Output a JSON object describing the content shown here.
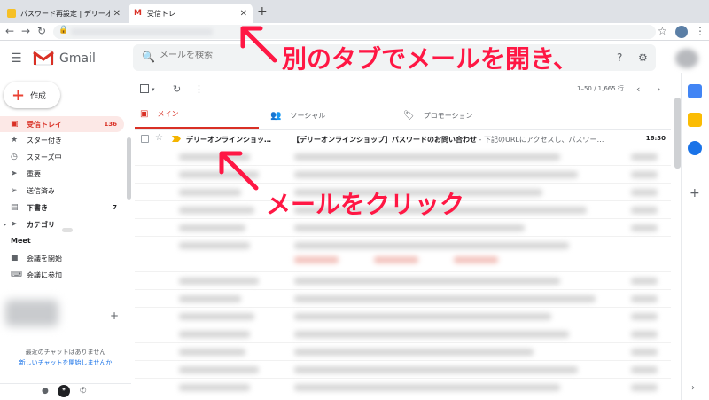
{
  "browser": {
    "tabs": [
      {
        "label": "パスワード再設定 | デリーオンラ"
      },
      {
        "label": "受信トレ"
      }
    ],
    "new_tab": "+"
  },
  "gmail": {
    "brand": "Gmail",
    "search_placeholder": "メールを検索",
    "compose_label": "作成",
    "sidebar": [
      {
        "label": "受信トレイ",
        "count": "136"
      },
      {
        "label": "スター付き",
        "count": ""
      },
      {
        "label": "スヌーズ中",
        "count": ""
      },
      {
        "label": "重要",
        "count": ""
      },
      {
        "label": "送信済み",
        "count": ""
      },
      {
        "label": "下書き",
        "count": "7"
      },
      {
        "label": "カテゴリ",
        "count": ""
      }
    ],
    "meet": {
      "label": "Meet",
      "start": "会議を開始",
      "join": "会議に参加"
    },
    "chat": {
      "empty": "最近のチャットはありません",
      "start_new": "新しいチャットを開始しませんか"
    },
    "pagination": "1–50 / 1,665 行",
    "categories": [
      "メイン",
      "ソーシャル",
      "プロモーション"
    ],
    "email": {
      "sender": "デリーオンラインショッ…",
      "subject": "【デリーオンラインショップ】パスワードのお問い合わせ",
      "snippet": " - 下記のURLにアクセスし、パスワー…",
      "time": "16:30"
    }
  },
  "annotations": {
    "tab_note": "別のタブでメールを開き、",
    "click_note": "メールをクリック"
  },
  "colors": {
    "accent": "#d93025",
    "annotation": "#ff1744",
    "important_marker": "#f4b400"
  }
}
